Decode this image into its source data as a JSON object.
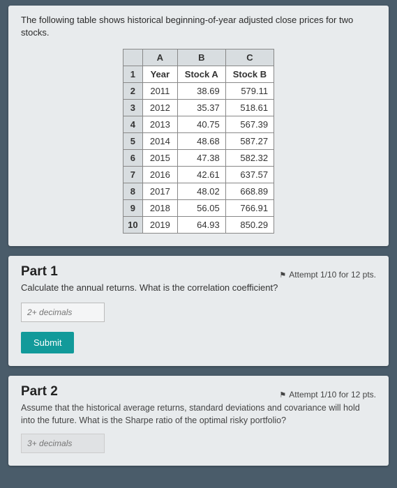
{
  "intro": "The following table shows historical beginning-of-year adjusted close prices for two stocks.",
  "table": {
    "colHeads": [
      "A",
      "B",
      "C"
    ],
    "header": {
      "a": "Year",
      "b": "Stock A",
      "c": "Stock B"
    },
    "rows": [
      {
        "n": "1",
        "a": "Year",
        "b": "Stock A",
        "c": "Stock B"
      },
      {
        "n": "2",
        "a": "2011",
        "b": "38.69",
        "c": "579.11"
      },
      {
        "n": "3",
        "a": "2012",
        "b": "35.37",
        "c": "518.61"
      },
      {
        "n": "4",
        "a": "2013",
        "b": "40.75",
        "c": "567.39"
      },
      {
        "n": "5",
        "a": "2014",
        "b": "48.68",
        "c": "587.27"
      },
      {
        "n": "6",
        "a": "2015",
        "b": "47.38",
        "c": "582.32"
      },
      {
        "n": "7",
        "a": "2016",
        "b": "42.61",
        "c": "637.57"
      },
      {
        "n": "8",
        "a": "2017",
        "b": "48.02",
        "c": "668.89"
      },
      {
        "n": "9",
        "a": "2018",
        "b": "56.05",
        "c": "766.91"
      },
      {
        "n": "10",
        "a": "2019",
        "b": "64.93",
        "c": "850.29"
      }
    ]
  },
  "part1": {
    "title": "Part 1",
    "attempt": "Attempt 1/10 for 12 pts.",
    "desc": "Calculate the annual returns. What is the correlation coefficient?",
    "placeholder": "2+ decimals",
    "submit": "Submit"
  },
  "part2": {
    "title": "Part 2",
    "attempt": "Attempt 1/10 for 12 pts.",
    "desc": "Assume that the historical average returns, standard deviations and covariance will hold into the future. What is the Sharpe ratio of the optimal risky portfolio?",
    "placeholder": "3+ decimals"
  }
}
